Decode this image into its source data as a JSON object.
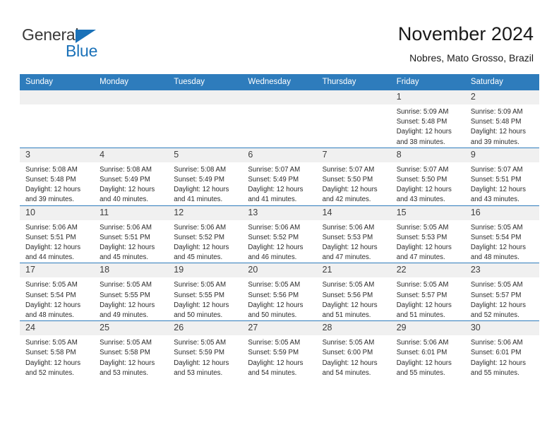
{
  "logo": {
    "word1": "General",
    "word2": "Blue",
    "triangle_color": "#1a71b8"
  },
  "header": {
    "title": "November 2024",
    "subtitle": "Nobres, Mato Grosso, Brazil"
  },
  "theme": {
    "header_blue": "#2e7cbc",
    "daynum_gray": "#f0f0f0",
    "text": "#2b2b2b"
  },
  "labels": {
    "sunrise_prefix": "Sunrise: ",
    "sunset_prefix": "Sunset: ",
    "daylight_prefix": "Daylight: "
  },
  "weekdays": [
    "Sunday",
    "Monday",
    "Tuesday",
    "Wednesday",
    "Thursday",
    "Friday",
    "Saturday"
  ],
  "weeks": [
    [
      {
        "day": "",
        "empty": true
      },
      {
        "day": "",
        "empty": true
      },
      {
        "day": "",
        "empty": true
      },
      {
        "day": "",
        "empty": true
      },
      {
        "day": "",
        "empty": true
      },
      {
        "day": "1",
        "sunrise": "Sunrise: 5:09 AM",
        "sunset": "Sunset: 5:48 PM",
        "daylight": "Daylight: 12 hours and 38 minutes."
      },
      {
        "day": "2",
        "sunrise": "Sunrise: 5:09 AM",
        "sunset": "Sunset: 5:48 PM",
        "daylight": "Daylight: 12 hours and 39 minutes."
      }
    ],
    [
      {
        "day": "3",
        "sunrise": "Sunrise: 5:08 AM",
        "sunset": "Sunset: 5:48 PM",
        "daylight": "Daylight: 12 hours and 39 minutes."
      },
      {
        "day": "4",
        "sunrise": "Sunrise: 5:08 AM",
        "sunset": "Sunset: 5:49 PM",
        "daylight": "Daylight: 12 hours and 40 minutes."
      },
      {
        "day": "5",
        "sunrise": "Sunrise: 5:08 AM",
        "sunset": "Sunset: 5:49 PM",
        "daylight": "Daylight: 12 hours and 41 minutes."
      },
      {
        "day": "6",
        "sunrise": "Sunrise: 5:07 AM",
        "sunset": "Sunset: 5:49 PM",
        "daylight": "Daylight: 12 hours and 41 minutes."
      },
      {
        "day": "7",
        "sunrise": "Sunrise: 5:07 AM",
        "sunset": "Sunset: 5:50 PM",
        "daylight": "Daylight: 12 hours and 42 minutes."
      },
      {
        "day": "8",
        "sunrise": "Sunrise: 5:07 AM",
        "sunset": "Sunset: 5:50 PM",
        "daylight": "Daylight: 12 hours and 43 minutes."
      },
      {
        "day": "9",
        "sunrise": "Sunrise: 5:07 AM",
        "sunset": "Sunset: 5:51 PM",
        "daylight": "Daylight: 12 hours and 43 minutes."
      }
    ],
    [
      {
        "day": "10",
        "sunrise": "Sunrise: 5:06 AM",
        "sunset": "Sunset: 5:51 PM",
        "daylight": "Daylight: 12 hours and 44 minutes."
      },
      {
        "day": "11",
        "sunrise": "Sunrise: 5:06 AM",
        "sunset": "Sunset: 5:51 PM",
        "daylight": "Daylight: 12 hours and 45 minutes."
      },
      {
        "day": "12",
        "sunrise": "Sunrise: 5:06 AM",
        "sunset": "Sunset: 5:52 PM",
        "daylight": "Daylight: 12 hours and 45 minutes."
      },
      {
        "day": "13",
        "sunrise": "Sunrise: 5:06 AM",
        "sunset": "Sunset: 5:52 PM",
        "daylight": "Daylight: 12 hours and 46 minutes."
      },
      {
        "day": "14",
        "sunrise": "Sunrise: 5:06 AM",
        "sunset": "Sunset: 5:53 PM",
        "daylight": "Daylight: 12 hours and 47 minutes."
      },
      {
        "day": "15",
        "sunrise": "Sunrise: 5:05 AM",
        "sunset": "Sunset: 5:53 PM",
        "daylight": "Daylight: 12 hours and 47 minutes."
      },
      {
        "day": "16",
        "sunrise": "Sunrise: 5:05 AM",
        "sunset": "Sunset: 5:54 PM",
        "daylight": "Daylight: 12 hours and 48 minutes."
      }
    ],
    [
      {
        "day": "17",
        "sunrise": "Sunrise: 5:05 AM",
        "sunset": "Sunset: 5:54 PM",
        "daylight": "Daylight: 12 hours and 48 minutes."
      },
      {
        "day": "18",
        "sunrise": "Sunrise: 5:05 AM",
        "sunset": "Sunset: 5:55 PM",
        "daylight": "Daylight: 12 hours and 49 minutes."
      },
      {
        "day": "19",
        "sunrise": "Sunrise: 5:05 AM",
        "sunset": "Sunset: 5:55 PM",
        "daylight": "Daylight: 12 hours and 50 minutes."
      },
      {
        "day": "20",
        "sunrise": "Sunrise: 5:05 AM",
        "sunset": "Sunset: 5:56 PM",
        "daylight": "Daylight: 12 hours and 50 minutes."
      },
      {
        "day": "21",
        "sunrise": "Sunrise: 5:05 AM",
        "sunset": "Sunset: 5:56 PM",
        "daylight": "Daylight: 12 hours and 51 minutes."
      },
      {
        "day": "22",
        "sunrise": "Sunrise: 5:05 AM",
        "sunset": "Sunset: 5:57 PM",
        "daylight": "Daylight: 12 hours and 51 minutes."
      },
      {
        "day": "23",
        "sunrise": "Sunrise: 5:05 AM",
        "sunset": "Sunset: 5:57 PM",
        "daylight": "Daylight: 12 hours and 52 minutes."
      }
    ],
    [
      {
        "day": "24",
        "sunrise": "Sunrise: 5:05 AM",
        "sunset": "Sunset: 5:58 PM",
        "daylight": "Daylight: 12 hours and 52 minutes."
      },
      {
        "day": "25",
        "sunrise": "Sunrise: 5:05 AM",
        "sunset": "Sunset: 5:58 PM",
        "daylight": "Daylight: 12 hours and 53 minutes."
      },
      {
        "day": "26",
        "sunrise": "Sunrise: 5:05 AM",
        "sunset": "Sunset: 5:59 PM",
        "daylight": "Daylight: 12 hours and 53 minutes."
      },
      {
        "day": "27",
        "sunrise": "Sunrise: 5:05 AM",
        "sunset": "Sunset: 5:59 PM",
        "daylight": "Daylight: 12 hours and 54 minutes."
      },
      {
        "day": "28",
        "sunrise": "Sunrise: 5:05 AM",
        "sunset": "Sunset: 6:00 PM",
        "daylight": "Daylight: 12 hours and 54 minutes."
      },
      {
        "day": "29",
        "sunrise": "Sunrise: 5:06 AM",
        "sunset": "Sunset: 6:01 PM",
        "daylight": "Daylight: 12 hours and 55 minutes."
      },
      {
        "day": "30",
        "sunrise": "Sunrise: 5:06 AM",
        "sunset": "Sunset: 6:01 PM",
        "daylight": "Daylight: 12 hours and 55 minutes."
      }
    ]
  ]
}
